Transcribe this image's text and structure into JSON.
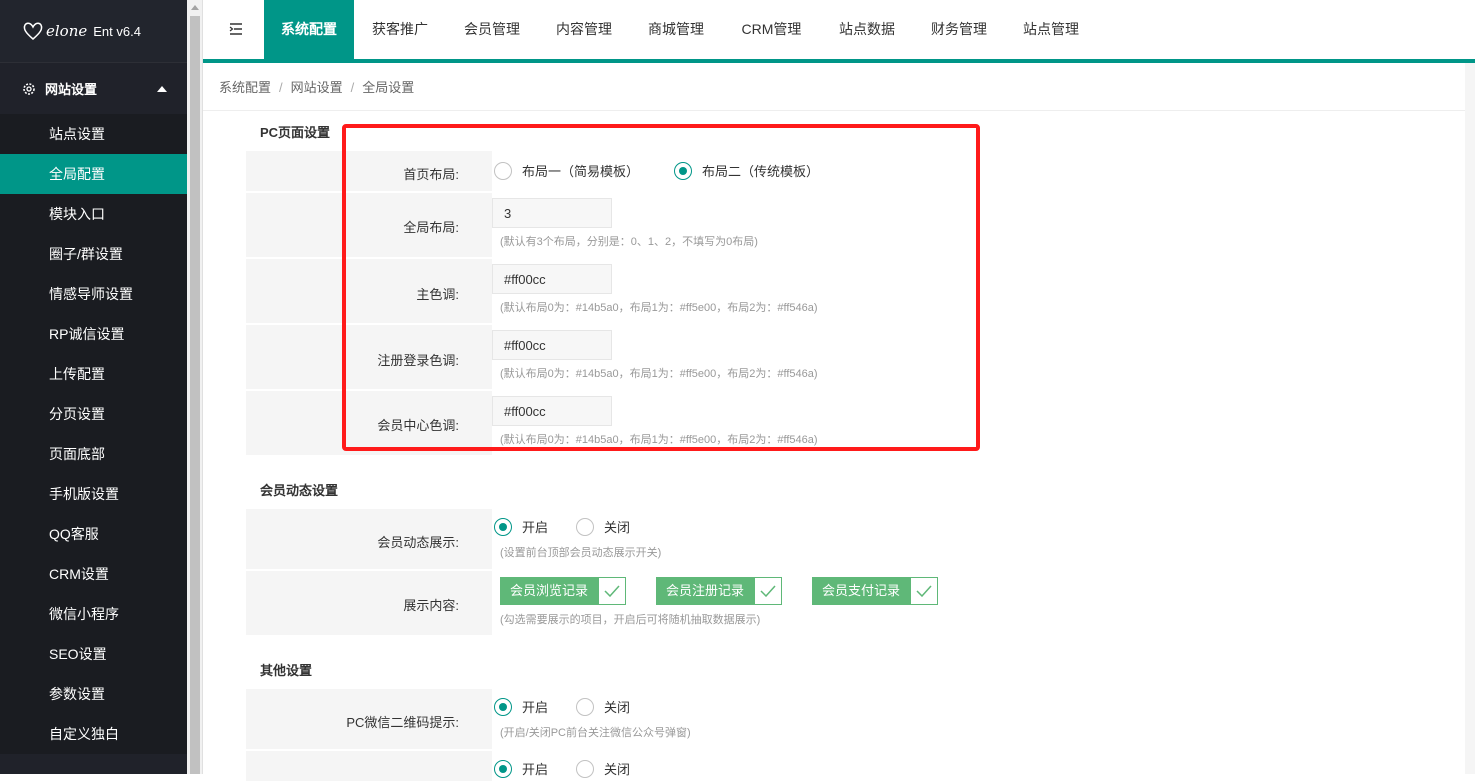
{
  "brand": {
    "script": "elone",
    "version": "Ent v6.4"
  },
  "sidebar": {
    "section": "网站设置",
    "items": [
      "站点设置",
      "全局配置",
      "模块入口",
      "圈子/群设置",
      "情感导师设置",
      "RP诚信设置",
      "上传配置",
      "分页设置",
      "页面底部",
      "手机版设置",
      "QQ客服",
      "CRM设置",
      "微信小程序",
      "SEO设置",
      "参数设置",
      "自定义独白"
    ],
    "active_index": 1
  },
  "topnav": [
    "系统配置",
    "获客推广",
    "会员管理",
    "内容管理",
    "商城管理",
    "CRM管理",
    "站点数据",
    "财务管理",
    "站点管理"
  ],
  "breadcrumb": [
    "系统配置",
    "网站设置",
    "全局设置"
  ],
  "sections": {
    "pc": {
      "title": "PC页面设置",
      "home_layout": {
        "label": "首页布局:",
        "opt1": "布局一（简易模板）",
        "opt2": "布局二（传统模板）"
      },
      "global_layout": {
        "label": "全局布局:",
        "value": "3",
        "hint": "(默认有3个布局，分别是：0、1、2，不填写为0布局)"
      },
      "main_color": {
        "label": "主色调:",
        "value": "#ff00cc",
        "hint": "(默认布局0为：#14b5a0，布局1为：#ff5e00，布局2为：#ff546a)"
      },
      "reg_color": {
        "label": "注册登录色调:",
        "value": "#ff00cc",
        "hint": "(默认布局0为：#14b5a0，布局1为：#ff5e00，布局2为：#ff546a)"
      },
      "center_color": {
        "label": "会员中心色调:",
        "value": "#ff00cc",
        "hint": "(默认布局0为：#14b5a0，布局1为：#ff5e00，布局2为：#ff546a)"
      }
    },
    "dynamic": {
      "title": "会员动态设置",
      "show": {
        "label": "会员动态展示:",
        "on": "开启",
        "off": "关闭",
        "hint": "(设置前台顶部会员动态展示开关)"
      },
      "content": {
        "label": "展示内容:",
        "tags": [
          "会员浏览记录",
          "会员注册记录",
          "会员支付记录"
        ],
        "hint": "(勾选需要展示的项目，开启后可将随机抽取数据展示)"
      }
    },
    "other": {
      "title": "其他设置",
      "wx_qr": {
        "label": "PC微信二维码提示:",
        "on": "开启",
        "off": "关闭",
        "hint": "(开启/关闭PC前台关注微信公众号弹窗)"
      },
      "next": {
        "on": "开启",
        "off": "关闭"
      }
    }
  },
  "colors": {
    "accent": "#009688",
    "sidebar": "#20222a",
    "tag": "#5fb878",
    "highlight": "#ff1a1a"
  }
}
